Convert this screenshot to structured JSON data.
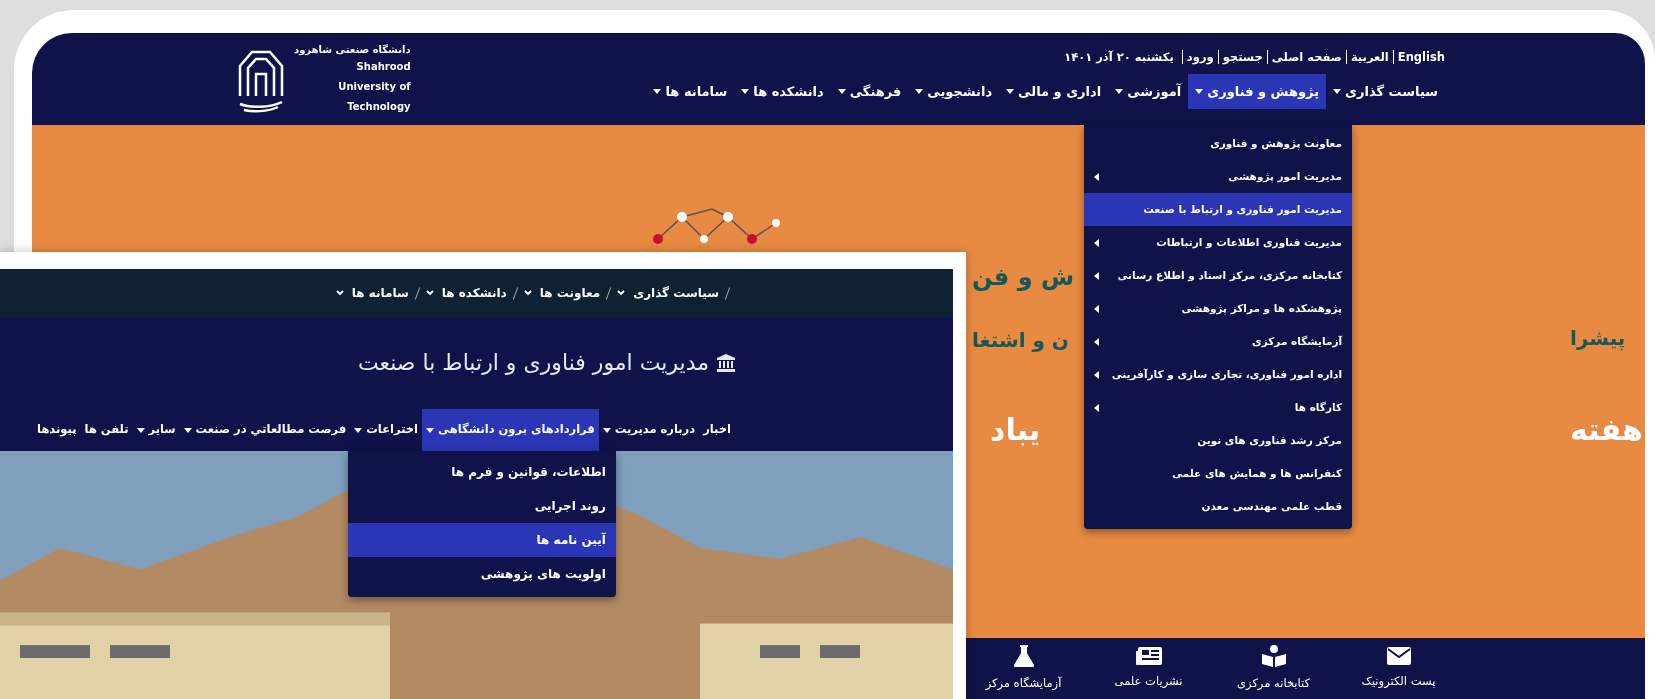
{
  "back_window": {
    "logo": {
      "name_fa": "دانشگاه صنعتی شاهرود",
      "name_en": "Shahrood University of Technology"
    },
    "top_links": [
      {
        "label": "English"
      },
      {
        "label": "العربية"
      },
      {
        "label": "صفحه اصلی"
      },
      {
        "label": "جستجو"
      },
      {
        "label": "ورود"
      }
    ],
    "date": "یکشنبه ۲۰ آذر ۱۴۰۱",
    "menu": [
      {
        "label": "سیاست گذاری",
        "selected": false,
        "has_submenu": true
      },
      {
        "label": "پژوهش و فناوری",
        "selected": true,
        "has_submenu": true
      },
      {
        "label": "آموزشی",
        "selected": false,
        "has_submenu": true
      },
      {
        "label": "اداری و مالی",
        "selected": false,
        "has_submenu": true
      },
      {
        "label": "دانشجویی",
        "selected": false,
        "has_submenu": true
      },
      {
        "label": "فرهنگی",
        "selected": false,
        "has_submenu": true
      },
      {
        "label": "دانشکده ها",
        "selected": false,
        "has_submenu": true
      },
      {
        "label": "سامانه ها",
        "selected": false,
        "has_submenu": true
      }
    ],
    "menu_dropdown": [
      {
        "label": "معاونت پژوهش و فناوری",
        "selected": false,
        "has_submenu": false
      },
      {
        "label": "مدیریت امور پژوهشی",
        "selected": false,
        "has_submenu": true
      },
      {
        "label": "مدیریت امور فناوری و ارتباط با صنعت",
        "selected": true,
        "has_submenu": false
      },
      {
        "label": "مدیریت فناوری اطلاعات و ارتباطات",
        "selected": false,
        "has_submenu": true
      },
      {
        "label": "کتابخانه مرکزی، مرکز اسناد و  اطلاع رسانی",
        "selected": false,
        "has_submenu": true
      },
      {
        "label": "پژوهشکده ها و مراکز پژوهشی",
        "selected": false,
        "has_submenu": true
      },
      {
        "label": "آزمایشگاه مرکزی",
        "selected": false,
        "has_submenu": true
      },
      {
        "label": "اداره امور فناوری، تجاری سازی و کارآفرینی",
        "selected": false,
        "has_submenu": true
      },
      {
        "label": "کارگاه ها",
        "selected": false,
        "has_submenu": true
      },
      {
        "label": "مرکز رشد فناوری های نوین",
        "selected": false,
        "has_submenu": false
      },
      {
        "label": "کنفرانس ها و همایش های علمی",
        "selected": false,
        "has_submenu": false
      },
      {
        "label": "قطب علمی مهندسی معدن",
        "selected": false,
        "has_submenu": false
      }
    ],
    "banner_text": [
      {
        "text": "ش و فن",
        "kind": "heading"
      },
      {
        "text": "پیشرا",
        "kind": "subheading"
      },
      {
        "text": "ن و اشتغا",
        "kind": "subheading"
      },
      {
        "text": "هفته",
        "kind": "slogan"
      },
      {
        "text": "یباد",
        "kind": "slogan"
      }
    ],
    "quick_links": [
      {
        "label": "پست الکترونیک"
      },
      {
        "label": "کتابخانه مرکزی"
      },
      {
        "label": "نشریات علمی"
      },
      {
        "label": "آزمایشگاه مرکز"
      }
    ]
  },
  "front_window": {
    "breadcrumb": [
      {
        "label": "سیاست گذاری"
      },
      {
        "label": "معاونت ها"
      },
      {
        "label": "دانشکده ها"
      },
      {
        "label": "سامانه ها"
      }
    ],
    "title": "مدیریت امور فناوری و ارتباط با صنعت",
    "nav": [
      {
        "label": "اخبار",
        "selected": false,
        "has_submenu": false
      },
      {
        "label": "درباره مدیریت",
        "selected": false,
        "has_submenu": true
      },
      {
        "label": "قراردادهای برون دانشگاهی",
        "selected": true,
        "has_submenu": true
      },
      {
        "label": "اختراعات",
        "selected": false,
        "has_submenu": true
      },
      {
        "label": "فرصت مطالعاتي در صنعت",
        "selected": false,
        "has_submenu": true
      },
      {
        "label": "سایر",
        "selected": false,
        "has_submenu": true
      },
      {
        "label": "تلفن ها",
        "selected": false,
        "has_submenu": false
      },
      {
        "label": "پیوندها",
        "selected": false,
        "has_submenu": false
      }
    ],
    "nav_dropdown": [
      {
        "label": "اطلاعات، قوانین و فرم ها",
        "selected": false
      },
      {
        "label": "روند اجرایی",
        "selected": false
      },
      {
        "label": "آیین نامه ها",
        "selected": true
      },
      {
        "label": "اولویت های پژوهشی",
        "selected": false
      }
    ]
  }
}
